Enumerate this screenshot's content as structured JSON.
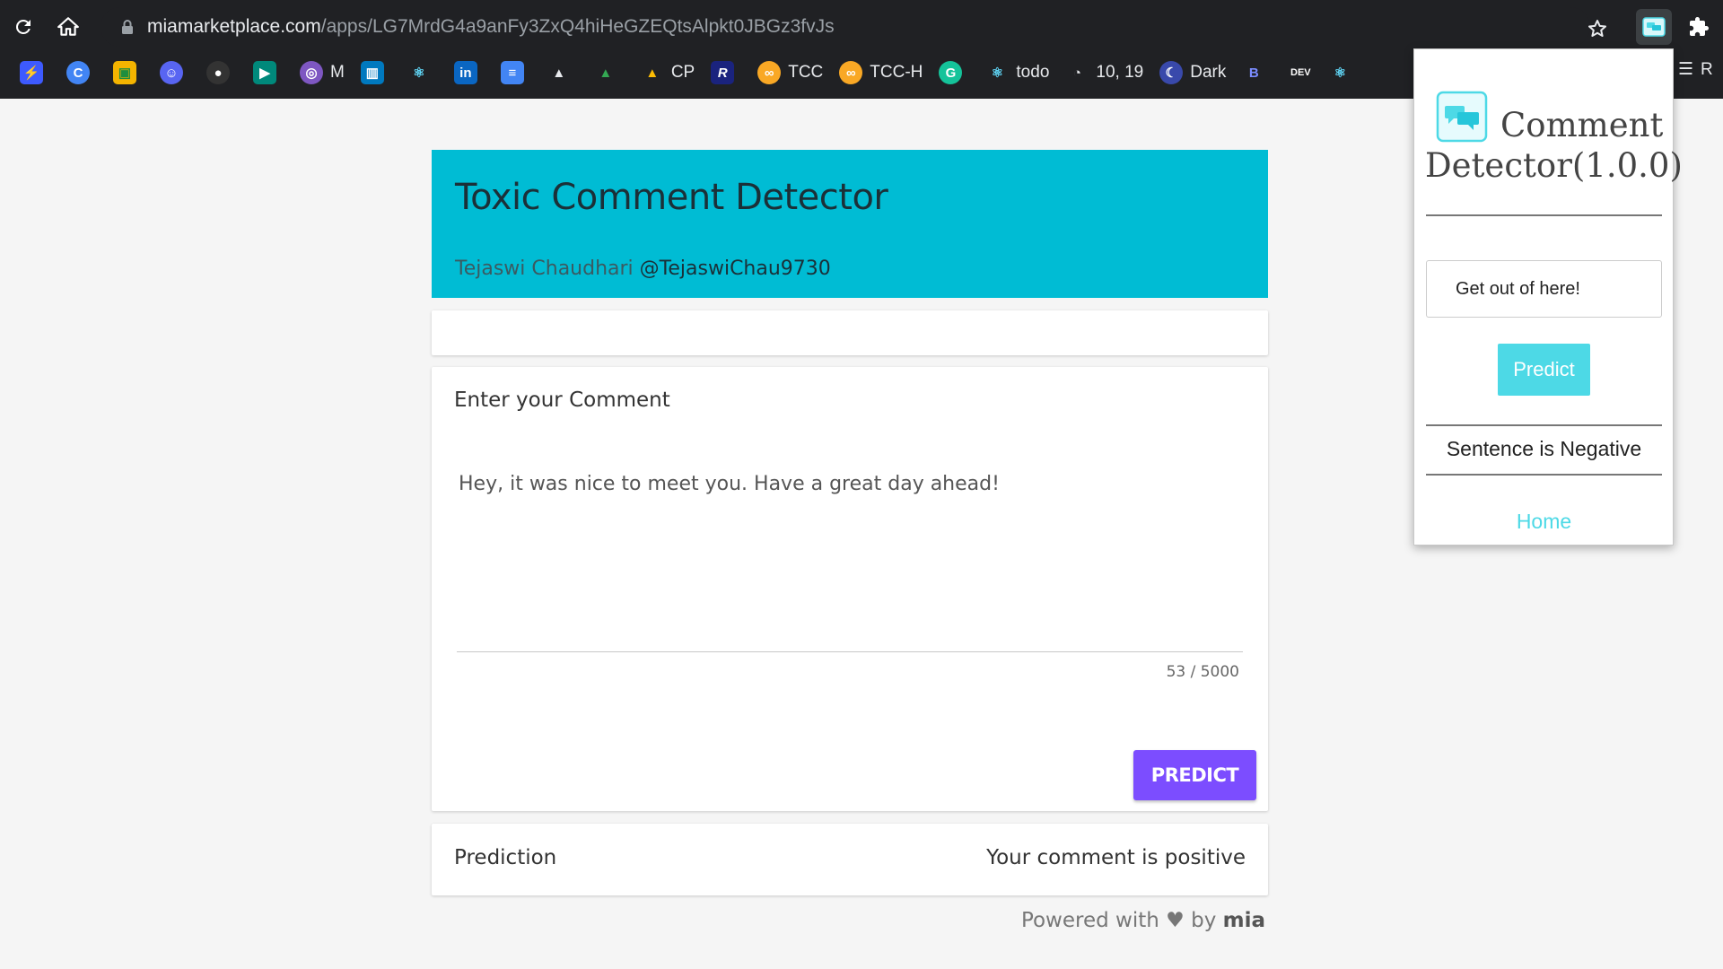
{
  "browser": {
    "url_host": "miamarketplace.com",
    "url_path": "/apps/LG7MrdG4a9anFy3ZxQ4hiHeGZEQtsAlpkt0JBGz3fvJs",
    "bookmarks": [
      {
        "label": "",
        "icon": "bolt-icon",
        "color": "#3d5afe"
      },
      {
        "label": "",
        "icon": "c-circle-icon",
        "color": "#4285f4"
      },
      {
        "label": "",
        "icon": "classroom-icon",
        "color": "#f4b400"
      },
      {
        "label": "",
        "icon": "discord-icon",
        "color": "#5865f2"
      },
      {
        "label": "",
        "icon": "github-icon",
        "color": "#333333"
      },
      {
        "label": "",
        "icon": "meet-icon",
        "color": "#00897b"
      },
      {
        "label": "M",
        "icon": "globe-icon",
        "color": "#7e57c2"
      },
      {
        "label": "",
        "icon": "trello-icon",
        "color": "#0079bf"
      },
      {
        "label": "",
        "icon": "react-icon",
        "color": "#202124"
      },
      {
        "label": "",
        "icon": "linkedin-icon",
        "color": "#0a66c2"
      },
      {
        "label": "",
        "icon": "docs-icon",
        "color": "#4285f4"
      },
      {
        "label": "",
        "icon": "mountain-icon",
        "color": "#202124"
      },
      {
        "label": "",
        "icon": "drive-icon",
        "color": "#202124"
      },
      {
        "label": "CP",
        "icon": "drive-icon",
        "color": "#202124"
      },
      {
        "label": "",
        "icon": "r-icon",
        "color": "#1a237e"
      },
      {
        "label": "TCC",
        "icon": "tcc-icon",
        "color": "#f9a825"
      },
      {
        "label": "TCC-H",
        "icon": "tcc-icon",
        "color": "#f9a825"
      },
      {
        "label": "",
        "icon": "grammarly-icon",
        "color": "#15c39a"
      },
      {
        "label": "todo",
        "icon": "react-icon",
        "color": "#202124"
      },
      {
        "label": "10, 19",
        "icon": "speedometer-icon",
        "color": "#202124"
      },
      {
        "label": "Dark",
        "icon": "moon-icon",
        "color": "#3949ab"
      },
      {
        "label": "",
        "icon": "bootstrap-icon",
        "color": "#202124"
      },
      {
        "label": "DEV",
        "icon": "dev-icon",
        "color": "#202124"
      },
      {
        "label": "",
        "icon": "react-icon",
        "color": "#202124"
      }
    ],
    "reading_list_label": "R"
  },
  "app": {
    "title": "Toxic Comment Detector",
    "author_name": "Tejaswi Chaudhari",
    "author_handle": "@TejaswiChau9730"
  },
  "comment": {
    "label": "Enter your Comment",
    "text": "Hey, it was nice to meet you. Have a great day ahead!",
    "char_count": "53 / 5000",
    "predict_label": "PREDICT"
  },
  "prediction": {
    "label": "Prediction",
    "value": "Your comment is positive"
  },
  "footer": {
    "prefix": "Powered with",
    "heart": "♥",
    "by": "by",
    "brand": "mia"
  },
  "extension_popup": {
    "title_line1": "Comment",
    "title_line2": "Detector(1.0.0)",
    "input_value": "Get out of here!",
    "predict_label": "Predict",
    "result": "Sentence is Negative",
    "home_label": "Home"
  },
  "colors": {
    "header_bg": "#00bcd4",
    "predict_button": "#7c4dff",
    "popup_accent": "#4dd9e6",
    "page_bg": "#f5f5f5",
    "chrome_bg": "#202124"
  }
}
